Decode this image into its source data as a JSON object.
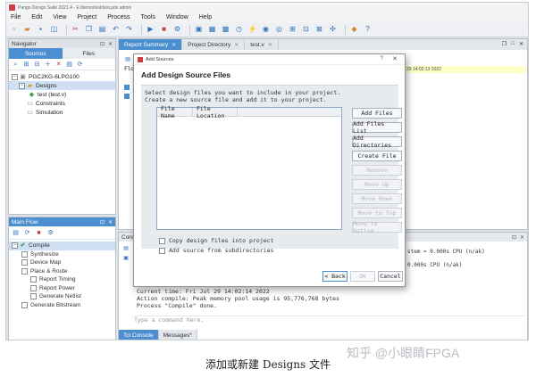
{
  "window": {
    "title": "Pango Design Suite 2021.4 - E:/demo/test/test.pds admin"
  },
  "menu": [
    "File",
    "Edit",
    "View",
    "Project",
    "Process",
    "Tools",
    "Window",
    "Help"
  ],
  "toolbar_icons": [
    "new-file-icon",
    "open-icon",
    "save-icon",
    "save-all-icon",
    "cut-icon",
    "copy-icon",
    "paste-icon",
    "undo-icon",
    "redo-icon",
    "run-icon",
    "stop-icon",
    "compile-icon",
    "synthesize-icon",
    "device-map-icon",
    "place-route-icon",
    "timing-icon",
    "power-icon",
    "netlist-icon",
    "bitstream-icon",
    "program-icon",
    "debug-icon",
    "ip-icon",
    "settings-icon",
    "info-icon",
    "help-icon"
  ],
  "navigator": {
    "title": "Navigator",
    "tabs": [
      "Sources",
      "Files"
    ],
    "tree": [
      {
        "label": "PGC2KG-6LPG100",
        "level": 0
      },
      {
        "label": "Designs",
        "level": 1
      },
      {
        "label": "test (test.v)",
        "level": 2
      },
      {
        "label": "Constraints",
        "level": 1
      },
      {
        "label": "Simulation",
        "level": 1
      }
    ]
  },
  "flow": {
    "title": "Main Flow",
    "steps": [
      {
        "label": "Compile",
        "level": 0
      },
      {
        "label": "Synthesize",
        "level": 1
      },
      {
        "label": "Device Map",
        "level": 1
      },
      {
        "label": "Place & Route",
        "level": 1
      },
      {
        "label": "Report Timing",
        "level": 2
      },
      {
        "label": "Report Power",
        "level": 2
      },
      {
        "label": "Generate Netlist",
        "level": 2
      },
      {
        "label": "Generate Bitstream",
        "level": 1
      }
    ]
  },
  "editor": {
    "tabs": [
      "Report Summary",
      "Project Directory",
      "test.v"
    ],
    "behind_text": [
      "Flo"
    ],
    "timestamp_highlight": "29 14:02:13 2022"
  },
  "console": {
    "title": "Console",
    "partial_prefix": [
      "Cu",
      "Ac",
      "Pr",
      "Ac",
      "Sa",
      "Sa",
      "Ac",
      "Ac",
      "Ac"
    ],
    "lines": [
      "Current time: Fri Jul 29 14:02:14 2022",
      "Action compile: Peak memory pool usage is 95,776,768 bytes",
      "Process \"Compile\" done."
    ],
    "right_fragments": [
      "stem = 0.000s CPU (n/ak)",
      "0.000s CPU (n/ak)"
    ],
    "command_placeholder": "Type a command here.",
    "tabs": [
      "Tcl Console",
      "Messages*"
    ]
  },
  "dialog": {
    "window_title": "Add Sources",
    "help_glyph": "?",
    "close_glyph": "✕",
    "heading": "Add Design Source Files",
    "description_1": "Select design files you want to include in your project.",
    "description_2": "Create a new source file and add it to your project.",
    "table_headers": [
      "File Name",
      "File Location"
    ],
    "buttons": [
      {
        "label": "Add Files",
        "enabled": true
      },
      {
        "label": "Add Files List",
        "enabled": true
      },
      {
        "label": "Add Directories",
        "enabled": true
      },
      {
        "label": "Create File",
        "enabled": true
      },
      {
        "label": "Remove",
        "enabled": false
      },
      {
        "label": "Move Up",
        "enabled": false
      },
      {
        "label": "Move Down",
        "enabled": false
      },
      {
        "label": "Move to Top",
        "enabled": false
      },
      {
        "label": "Move to Bottom",
        "enabled": false
      }
    ],
    "checkbox_copy": "Copy design files into project",
    "checkbox_subdirs": "Add source from subdirectories",
    "back_label": "< Back",
    "ok_label": "OK",
    "cancel_label": "Cancel"
  },
  "caption": "添加或新建 Designs 文件",
  "watermark": "知乎 @小眼睛FPGA"
}
